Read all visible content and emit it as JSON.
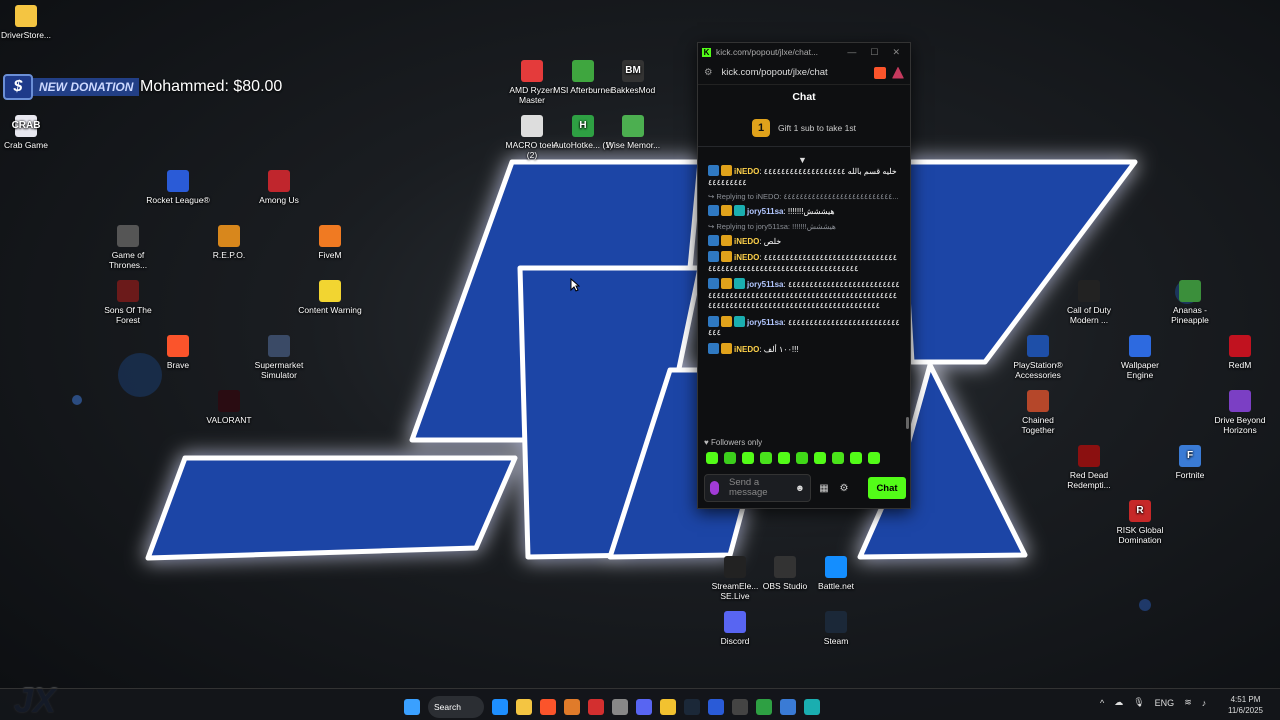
{
  "donation": {
    "badge": "$",
    "tag": "NEW DONATION",
    "text": "Mohammed: $80.00"
  },
  "desktop_icons": [
    {
      "label": "DriverStore...",
      "color": "#f4c542",
      "glyph": ""
    },
    {
      "label": "Crab Game",
      "color": "#e8e8f0",
      "glyph": "CRAB"
    },
    {
      "label": "Rocket League®",
      "color": "#2a5bd7",
      "glyph": ""
    },
    {
      "label": "Among Us",
      "color": "#c0262d",
      "glyph": ""
    },
    {
      "label": "Game of Thrones...",
      "color": "#555",
      "glyph": ""
    },
    {
      "label": "R.E.P.O.",
      "color": "#d8871c",
      "glyph": ""
    },
    {
      "label": "FiveM",
      "color": "#f07a22",
      "glyph": ""
    },
    {
      "label": "Sons Of The Forest",
      "color": "#6b1a1a",
      "glyph": ""
    },
    {
      "label": "Content Warning",
      "color": "#f2d531",
      "glyph": ""
    },
    {
      "label": "Brave",
      "color": "#fb542b",
      "glyph": ""
    },
    {
      "label": "Supermarket Simulator",
      "color": "#3a4a66",
      "glyph": ""
    },
    {
      "label": "VALORANT",
      "color": "#2a0c12",
      "glyph": ""
    },
    {
      "label": "AMD Ryzen Master",
      "color": "#e43b3b",
      "glyph": ""
    },
    {
      "label": "MSI Afterburner",
      "color": "#3fa63f",
      "glyph": ""
    },
    {
      "label": "BakkesMod",
      "color": "#333",
      "glyph": "BM"
    },
    {
      "label": "MACRO toekr (2)",
      "color": "#ddd",
      "glyph": ""
    },
    {
      "label": "AutoHotke... (1)",
      "color": "#2ea043",
      "glyph": "H"
    },
    {
      "label": "Wise Memor...",
      "color": "#4caf50",
      "glyph": ""
    },
    {
      "label": "Call of Duty Modern ...",
      "color": "#222",
      "glyph": ""
    },
    {
      "label": "Ananas - Pineapple",
      "color": "#3b8f3b",
      "glyph": ""
    },
    {
      "label": "PlayStation® Accessories",
      "color": "#1e4fa8",
      "glyph": ""
    },
    {
      "label": "Wallpaper Engine",
      "color": "#2d6ae0",
      "glyph": ""
    },
    {
      "label": "RedM",
      "color": "#c1121f",
      "glyph": ""
    },
    {
      "label": "Chained Together",
      "color": "#b5472a",
      "glyph": ""
    },
    {
      "label": "Drive Beyond Horizons",
      "color": "#7b3fc4",
      "glyph": ""
    },
    {
      "label": "Red Dead Redempti...",
      "color": "#8b1010",
      "glyph": ""
    },
    {
      "label": "Fortnite",
      "color": "#3a7bd5",
      "glyph": "F"
    },
    {
      "label": "RISK Global Domination",
      "color": "#c62828",
      "glyph": "R"
    },
    {
      "label": "StreamEle... SE.Live",
      "color": "#222",
      "glyph": ""
    },
    {
      "label": "OBS Studio",
      "color": "#333",
      "glyph": ""
    },
    {
      "label": "Battle.net",
      "color": "#148eff",
      "glyph": ""
    },
    {
      "label": "Discord",
      "color": "#5865f2",
      "glyph": ""
    },
    {
      "label": "Steam",
      "color": "#1b2838",
      "glyph": ""
    }
  ],
  "chat_window": {
    "tab_title": "kick.com/popout/jlxe/chat...",
    "url": "kick.com/popout/jlxe/chat",
    "header": "Chat",
    "gift_number": "1",
    "gift_text": "Gift 1 sub to take 1st",
    "followers_only": "Followers only",
    "placeholder": "Send a message",
    "send_label": "Chat"
  },
  "messages": [
    {
      "type": "msg",
      "user": "iNEDO",
      "ucls": "u1",
      "badges": [
        "b-mod",
        "b-og"
      ],
      "text": ": خليه قسم بالله ٤٤٤٤٤٤٤٤٤٤٤٤٤٤٤٤٤٤٤٤٤٤٤٤٤٤٤٤"
    },
    {
      "type": "reply",
      "text": "↪ Replying to iNEDO: ٤٤٤٤٤٤٤٤٤٤٤٤٤٤٤٤٤٤٤٤٤٤٤٤٤٤٤..."
    },
    {
      "type": "msg",
      "user": "jory511sa",
      "ucls": "u2",
      "badges": [
        "b-mod",
        "b-og",
        "b-sub"
      ],
      "text": ": !!!!!!!هيششش"
    },
    {
      "type": "reply",
      "text": "↪ Replying to jory511sa: !!!!!!!هيششش"
    },
    {
      "type": "msg",
      "user": "iNEDO",
      "ucls": "u1",
      "badges": [
        "b-mod",
        "b-og"
      ],
      "text": ": خلص"
    },
    {
      "type": "msg",
      "user": "iNEDO",
      "ucls": "u1",
      "badges": [
        "b-mod",
        "b-og"
      ],
      "text": ": ٤٤٤٤٤٤٤٤٤٤٤٤٤٤٤٤٤٤٤٤٤٤٤٤٤٤٤٤٤٤٤٤٤٤٤٤٤٤٤٤٤٤٤٤٤٤٤٤٤٤٤٤٤٤٤٤٤٤٤٤٤٤٤٤٤٤"
    },
    {
      "type": "msg",
      "user": "jory511sa",
      "ucls": "u2",
      "badges": [
        "b-mod",
        "b-og",
        "b-sub"
      ],
      "text": ": ٤٤٤٤٤٤٤٤٤٤٤٤٤٤٤٤٤٤٤٤٤٤٤٤٤٤٤٤٤٤٤٤٤٤٤٤٤٤٤٤٤٤٤٤٤٤٤٤٤٤٤٤٤٤٤٤٤٤٤٤٤٤٤٤٤٤٤٤٤٤٤٤٤٤٤٤٤٤٤٤٤٤٤٤٤٤٤٤٤٤٤٤٤٤٤٤٤٤٤٤٤٤٤٤٤٤٤٤٤٤"
    },
    {
      "type": "msg",
      "user": "jory511sa",
      "ucls": "u2",
      "badges": [
        "b-mod",
        "b-og",
        "b-sub"
      ],
      "text": ": ٤٤٤٤٤٤٤٤٤٤٤٤٤٤٤٤٤٤٤٤٤٤٤٤٤٤٤٤٤"
    },
    {
      "type": "msg",
      "user": "iNEDO",
      "ucls": "u1",
      "badges": [
        "b-mod",
        "b-og"
      ],
      "text": ": ١٠٠ ألف!!!"
    }
  ],
  "emotes": [
    "#53fc18",
    "#3ccf1c",
    "#53fc18",
    "#49e21c",
    "#53fc18",
    "#40d818",
    "#53fc18",
    "#4ae41a",
    "#53fc18",
    "#53fc18"
  ],
  "taskbar": {
    "search_label": "Search",
    "icons": [
      "#1e8fff",
      "#f4c542",
      "#fb542b",
      "#e07b2a",
      "#d32f2f",
      "#888",
      "#5865f2",
      "#f2c230",
      "#1b2838",
      "#2a5bd7",
      "#444",
      "#2ea043",
      "#3a7bd5",
      "#1aaeb0"
    ],
    "lang": "ENG",
    "time": "4:51 PM",
    "date": "11/6/2025"
  },
  "corner_logo": "JX"
}
